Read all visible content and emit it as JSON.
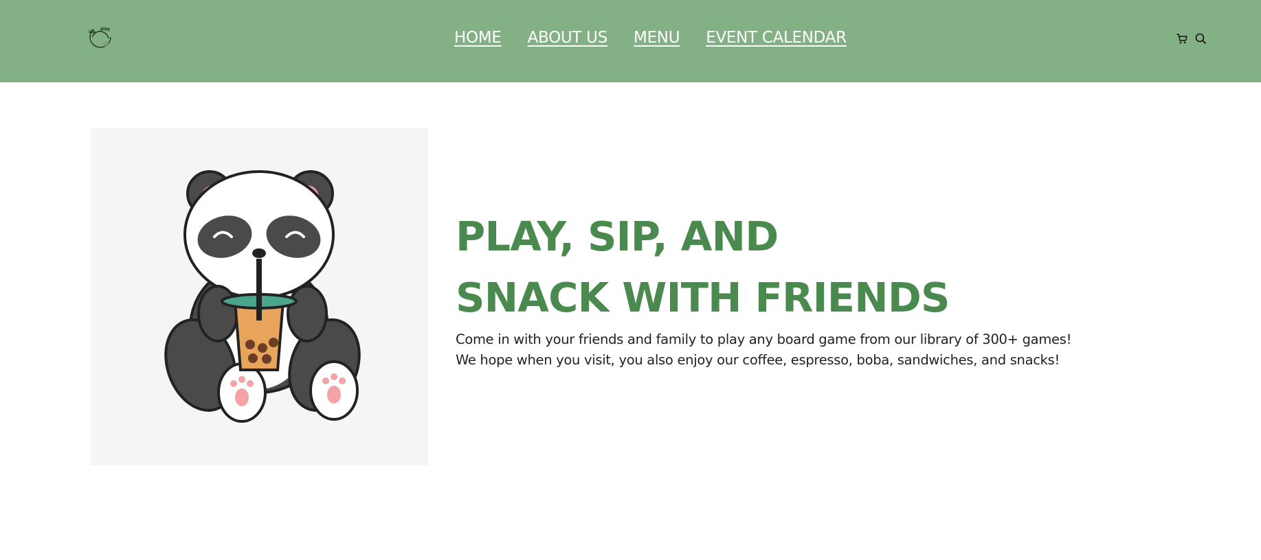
{
  "header": {
    "logo_alt": "Sip N Play logo",
    "background": "#83b084"
  },
  "nav": {
    "items": [
      {
        "label": "HOME"
      },
      {
        "label": "ABOUT US"
      },
      {
        "label": "MENU"
      },
      {
        "label": "EVENT CALENDAR"
      }
    ]
  },
  "header_icons": {
    "cart": "cart-icon",
    "search": "search-icon"
  },
  "hero": {
    "image_alt": "Panda drinking bubble tea",
    "headline_line1": "PLAY, SIP, AND",
    "headline_line2": "SNACK WITH FRIENDS",
    "body_line1": "Come in with your friends and family to play any board game from our library of 300+ games!",
    "body_line2": "We hope when you visit, you also enjoy our coffee, espresso, boba, sandwiches, and snacks!",
    "accent_color": "#4b8a4f"
  }
}
